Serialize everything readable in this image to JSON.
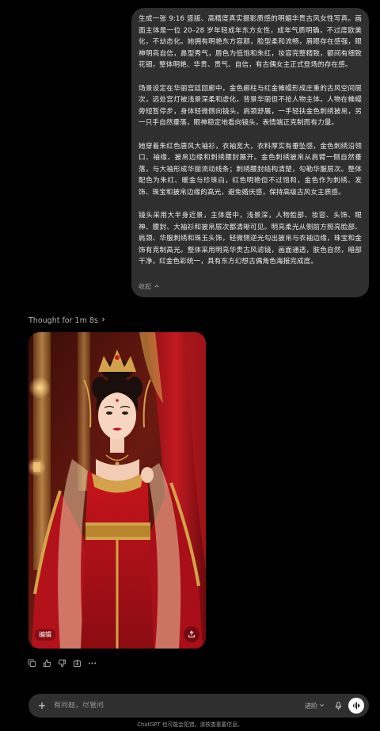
{
  "message": {
    "paragraphs": [
      "生成一张 9:16 竖版、高精度真实摄影质感的明媚华贵古风女性写真。画面主体是一位 20–28 岁年轻成年东方女性，成年气质明确，不过度欧美化，不幼态化。她拥有明艳东方容颜，脸型柔和流畅，眉眼存在感强，眼神明亮自信，鼻型秀气，唇色为低饱和朱红，妆容完整精致，额间有细致花钿，整体明艳、华贵、贵气、自信，有古偶女主正式登场的存在感。",
      "场景设定在华丽宫廷回廊中，金色廊柱与红金帷幔形成庄重的古风空间层次，远处宫灯被浅景深柔和虚化，背景华丽但不抢人物主体。人物在帷幔旁短暂停步，身体轻微侧向镜头，肩颈舒展，一手轻扶金色刺绣披帛，另一只手自然垂落，眼神稳定地看向镜头，表情端正克制而有力量。",
      "她穿着朱红色唐风大袖衫，衣袖宽大，衣料厚实有垂坠感，金色刺绣沿领口、袖缘、披帛边缘和刺绣腰封展开。金色刺绣披帛从肩臂一侧自然垂落，与大袖形成华丽流动线条；刺绣腰封结构清楚，勾勒华服层次。整体配色为朱红、暖金与珍珠白，红色明艳但不过饱和，金色作为刺绣、发饰、珠宝和披帛边缘的高光，避免婚庆感，保持高级古风女主质感。",
      "镜头采用大半身近景，主体居中，浅景深，人物脸部、妆容、头饰、眼神、腰封、大袖衫和披帛层次都清晰可见。明亮柔光从侧前方照亮脸部、肩颈、华服刺绣和珠玉头饰，轻微侧逆光勾出披帛与衣袖边缘，珠宝和金饰有克制高光。整体采用明亮华贵古风滤镜，画面通透，肤色自然，暗部干净，红金色彩统一，具有东方幻想古偶角色海报完成度。"
    ],
    "collapse_label": "收起"
  },
  "thought": {
    "label": "Thought for 1m 8s"
  },
  "image": {
    "edit_label": "编辑",
    "share_icon": "share-icon",
    "colors": {
      "dress": "#b3121b",
      "gold": "#d4a24a",
      "backdrop": "#5a1410"
    }
  },
  "actions": [
    "copy-icon",
    "thumbs-up-icon",
    "thumbs-down-icon",
    "share-icon",
    "more-icon"
  ],
  "composer": {
    "placeholder": "有问题，尽管问",
    "mode_label": "进阶"
  },
  "footer": {
    "disclaimer": "ChatGPT 也可能会犯错。请核查重要信息。"
  }
}
